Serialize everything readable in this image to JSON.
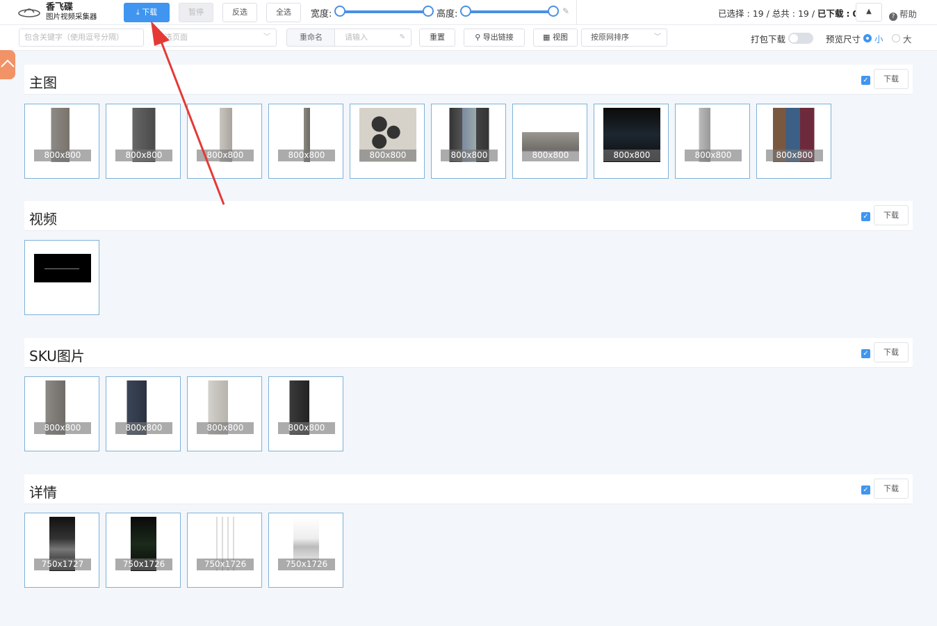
{
  "app": {
    "name": "香飞碟",
    "subtitle": "图片视频采集器"
  },
  "toolbar": {
    "download_label": "下载",
    "pause_label": "暂停",
    "invert_label": "反选",
    "select_all_label": "全选",
    "width_label": "宽度:",
    "height_label": "高度:",
    "stats": {
      "selected_label": "已选择",
      "selected": "19",
      "total_label": "总共",
      "total": "19",
      "downloaded_label": "已下载",
      "downloaded": "0"
    },
    "help_label": "帮助"
  },
  "filters": {
    "keyword_placeholder": "包含关键字（使用逗号分隔）",
    "page_select_placeholder": "选页面",
    "rename_label": "重命名",
    "rename_placeholder": "请输入",
    "reset_label": "重置",
    "export_label": "导出链接",
    "view_label": "视图",
    "sort_label": "按原网排序",
    "pack_download_label": "打包下载",
    "preview_size_label": "预览尺寸",
    "size_small": "小",
    "size_large": "大"
  },
  "sections": [
    {
      "title": "主图",
      "button": "下载",
      "items": [
        "800x800",
        "800x800",
        "800x800",
        "800x800",
        "800x800",
        "800x800",
        "800x800",
        "800x800",
        "800x800",
        "800x800"
      ]
    },
    {
      "title": "视频",
      "button": "下载",
      "items": [
        ""
      ]
    },
    {
      "title": "SKU图片",
      "button": "下载",
      "items": [
        "800x800",
        "800x800",
        "800x800",
        "800x800"
      ]
    },
    {
      "title": "详情",
      "button": "下载",
      "items": [
        "750x1727",
        "750x1726",
        "750x1726",
        "750x1726"
      ]
    }
  ],
  "colors": {
    "accent": "#3f95f0",
    "thumb_border": "#7fb1d6",
    "arrow": "#e53935",
    "side_tab": "#f29367"
  }
}
